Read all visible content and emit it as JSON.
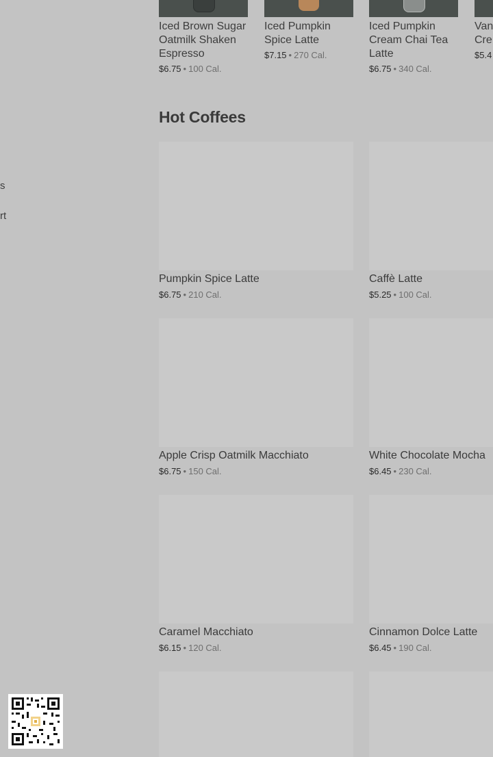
{
  "sidebar": {
    "fragments": [
      "s",
      "rt"
    ]
  },
  "top_row": [
    {
      "name": "Iced Brown Sugar Oatmilk Shaken Espresso",
      "price": "$6.75",
      "separator": "•",
      "calories": "100 Cal.",
      "image_color": "#3f4844"
    },
    {
      "name": "Iced Pumpkin Spice Latte",
      "price": "$7.15",
      "separator": "•",
      "calories": "270 Cal.",
      "image_color": "#b8875a"
    },
    {
      "name": "Iced Pumpkin Cream Chai Tea Latte",
      "price": "$6.75",
      "separator": "•",
      "calories": "340 Cal.",
      "image_color": "#8a8e8c"
    },
    {
      "name_lines": [
        "Van",
        "Cre"
      ],
      "price": "$5.4",
      "image_color": "#3f4844"
    }
  ],
  "section": {
    "title": "Hot Coffees"
  },
  "products": [
    {
      "name": "Pumpkin Spice Latte",
      "price": "$6.75",
      "separator": "•",
      "calories": "210 Cal."
    },
    {
      "name": "Caffè Latte",
      "price": "$5.25",
      "separator": "•",
      "calories": "100 Cal."
    },
    {
      "name": "Apple Crisp Oatmilk Macchiato",
      "price": "$6.75",
      "separator": "•",
      "calories": "150 Cal."
    },
    {
      "name": "White Chocolate Mocha",
      "price": "$6.45",
      "separator": "•",
      "calories": "230 Cal."
    },
    {
      "name": "Caramel Macchiato",
      "price": "$6.15",
      "separator": "•",
      "calories": "120 Cal."
    },
    {
      "name": "Cinnamon Dolce Latte",
      "price": "$6.45",
      "separator": "•",
      "calories": "190 Cal."
    },
    {},
    {}
  ],
  "colors": {
    "page_background": "#c3c3c3",
    "image_placeholder": "#c9c9c9",
    "text_primary": "#3a3a3a",
    "text_muted": "#6e6e6e"
  },
  "qr_code": {
    "icon": "qr-code-icon"
  }
}
